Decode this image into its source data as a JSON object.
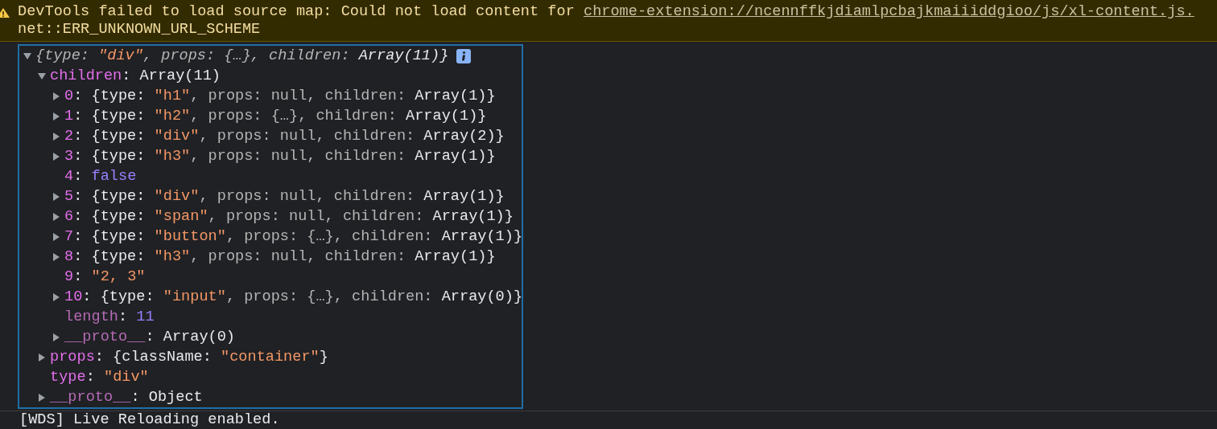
{
  "warning": {
    "message": "DevTools failed to load source map: Could not load content for ",
    "link": "chrome-extension://ncennffkjdiamlpcbajkmaiiiddgioo/js/xl-content.js.",
    "detail": "net::ERR_UNKNOWN_URL_SCHEME"
  },
  "tree": [
    {
      "expandable": true,
      "expanded": true,
      "italic": true,
      "info_badge": true,
      "segments": [
        {
          "kind": "punct",
          "text": "{type: "
        },
        {
          "kind": "string",
          "text": "\"div\""
        },
        {
          "kind": "punct",
          "text": ", props: {…}, children: "
        },
        {
          "kind": "plain",
          "text": "Array(11)}"
        }
      ],
      "children": [
        {
          "expandable": true,
          "expanded": true,
          "segments": [
            {
              "kind": "key",
              "text": "children"
            },
            {
              "kind": "plain",
              "text": ": Array(11)"
            }
          ],
          "children": [
            {
              "expandable": true,
              "expanded": false,
              "segments": [
                {
                  "kind": "key",
                  "text": "0"
                },
                {
                  "kind": "plain",
                  "text": ": {type: "
                },
                {
                  "kind": "string",
                  "text": "\"h1\""
                },
                {
                  "kind": "punct",
                  "text": ", props: null, children: "
                },
                {
                  "kind": "plain",
                  "text": "Array(1)}"
                }
              ]
            },
            {
              "expandable": true,
              "expanded": false,
              "segments": [
                {
                  "kind": "key",
                  "text": "1"
                },
                {
                  "kind": "plain",
                  "text": ": {type: "
                },
                {
                  "kind": "string",
                  "text": "\"h2\""
                },
                {
                  "kind": "punct",
                  "text": ", props: {…}, children: "
                },
                {
                  "kind": "plain",
                  "text": "Array(1)}"
                }
              ]
            },
            {
              "expandable": true,
              "expanded": false,
              "segments": [
                {
                  "kind": "key",
                  "text": "2"
                },
                {
                  "kind": "plain",
                  "text": ": {type: "
                },
                {
                  "kind": "string",
                  "text": "\"div\""
                },
                {
                  "kind": "punct",
                  "text": ", props: null, children: "
                },
                {
                  "kind": "plain",
                  "text": "Array(2)}"
                }
              ]
            },
            {
              "expandable": true,
              "expanded": false,
              "segments": [
                {
                  "kind": "key",
                  "text": "3"
                },
                {
                  "kind": "plain",
                  "text": ": {type: "
                },
                {
                  "kind": "string",
                  "text": "\"h3\""
                },
                {
                  "kind": "punct",
                  "text": ", props: null, children: "
                },
                {
                  "kind": "plain",
                  "text": "Array(1)}"
                }
              ]
            },
            {
              "expandable": false,
              "expanded": false,
              "segments": [
                {
                  "kind": "key",
                  "text": "4"
                },
                {
                  "kind": "plain",
                  "text": ": "
                },
                {
                  "kind": "literal",
                  "text": "false"
                }
              ]
            },
            {
              "expandable": true,
              "expanded": false,
              "segments": [
                {
                  "kind": "key",
                  "text": "5"
                },
                {
                  "kind": "plain",
                  "text": ": {type: "
                },
                {
                  "kind": "string",
                  "text": "\"div\""
                },
                {
                  "kind": "punct",
                  "text": ", props: null, children: "
                },
                {
                  "kind": "plain",
                  "text": "Array(1)}"
                }
              ]
            },
            {
              "expandable": true,
              "expanded": false,
              "segments": [
                {
                  "kind": "key",
                  "text": "6"
                },
                {
                  "kind": "plain",
                  "text": ": {type: "
                },
                {
                  "kind": "string",
                  "text": "\"span\""
                },
                {
                  "kind": "punct",
                  "text": ", props: null, children: "
                },
                {
                  "kind": "plain",
                  "text": "Array(1)}"
                }
              ]
            },
            {
              "expandable": true,
              "expanded": false,
              "segments": [
                {
                  "kind": "key",
                  "text": "7"
                },
                {
                  "kind": "plain",
                  "text": ": {type: "
                },
                {
                  "kind": "string",
                  "text": "\"button\""
                },
                {
                  "kind": "punct",
                  "text": ", props: {…}, children: "
                },
                {
                  "kind": "plain",
                  "text": "Array(1)}"
                }
              ]
            },
            {
              "expandable": true,
              "expanded": false,
              "segments": [
                {
                  "kind": "key",
                  "text": "8"
                },
                {
                  "kind": "plain",
                  "text": ": {type: "
                },
                {
                  "kind": "string",
                  "text": "\"h3\""
                },
                {
                  "kind": "punct",
                  "text": ", props: null, children: "
                },
                {
                  "kind": "plain",
                  "text": "Array(1)}"
                }
              ]
            },
            {
              "expandable": false,
              "expanded": false,
              "segments": [
                {
                  "kind": "key",
                  "text": "9"
                },
                {
                  "kind": "plain",
                  "text": ": "
                },
                {
                  "kind": "string",
                  "text": "\"2, 3\""
                }
              ]
            },
            {
              "expandable": true,
              "expanded": false,
              "segments": [
                {
                  "kind": "key",
                  "text": "10"
                },
                {
                  "kind": "plain",
                  "text": ": {type: "
                },
                {
                  "kind": "string",
                  "text": "\"input\""
                },
                {
                  "kind": "punct",
                  "text": ", props: {…}, children: "
                },
                {
                  "kind": "plain",
                  "text": "Array(0)}"
                }
              ]
            },
            {
              "expandable": false,
              "expanded": false,
              "segments": [
                {
                  "kind": "dimkey",
                  "text": "length"
                },
                {
                  "kind": "plain",
                  "text": ": "
                },
                {
                  "kind": "literal",
                  "text": "11"
                }
              ]
            },
            {
              "expandable": true,
              "expanded": false,
              "segments": [
                {
                  "kind": "dimkey",
                  "text": "__proto__"
                },
                {
                  "kind": "plain",
                  "text": ": Array(0)"
                }
              ]
            }
          ]
        },
        {
          "expandable": true,
          "expanded": false,
          "segments": [
            {
              "kind": "key",
              "text": "props"
            },
            {
              "kind": "plain",
              "text": ": {className: "
            },
            {
              "kind": "string",
              "text": "\"container\""
            },
            {
              "kind": "plain",
              "text": "}"
            }
          ]
        },
        {
          "expandable": false,
          "expanded": false,
          "segments": [
            {
              "kind": "key",
              "text": "type"
            },
            {
              "kind": "plain",
              "text": ": "
            },
            {
              "kind": "string",
              "text": "\"div\""
            }
          ]
        },
        {
          "expandable": true,
          "expanded": false,
          "segments": [
            {
              "kind": "dimkey",
              "text": "__proto__"
            },
            {
              "kind": "plain",
              "text": ": Object"
            }
          ]
        }
      ]
    }
  ],
  "status_line": "[WDS] Live Reloading enabled."
}
